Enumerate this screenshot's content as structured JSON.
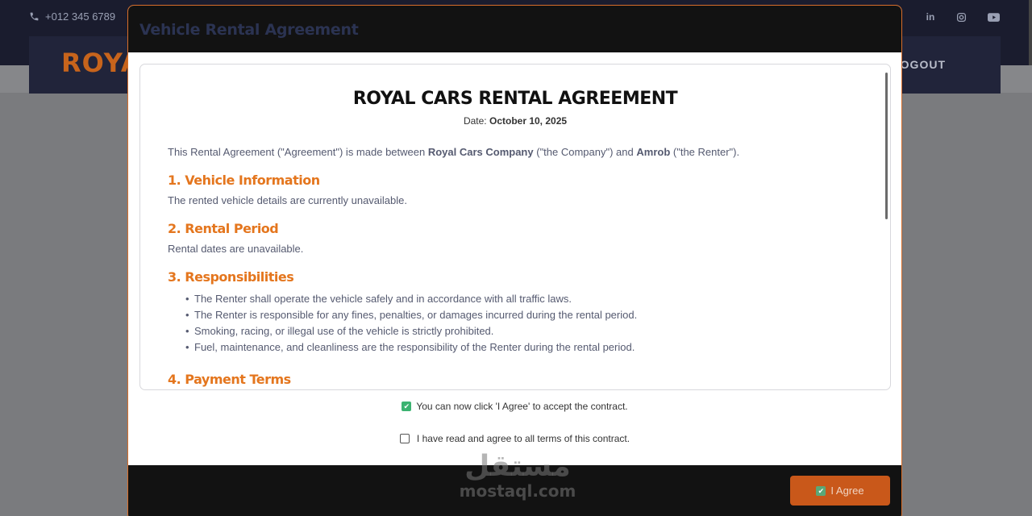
{
  "topbar": {
    "phone": "+012 345 6789",
    "social_icons": [
      "linkedin-icon",
      "instagram-icon",
      "youtube-icon"
    ]
  },
  "navbar": {
    "brand": "ROYAL",
    "logout": "LOGOUT"
  },
  "modal": {
    "title": "Vehicle Rental Agreement",
    "contract": {
      "title": "ROYAL CARS RENTAL AGREEMENT",
      "date_label": "Date:",
      "date_value": "October 10, 2025",
      "intro": {
        "prefix": "This Rental Agreement (\"Agreement\") is made between",
        "company": "Royal Cars Company",
        "mid": "(\"the Company\") and",
        "renter": "Amrob",
        "suffix": "(\"the Renter\")."
      },
      "sections": [
        {
          "heading": "1. Vehicle Information",
          "text": "The rented vehicle details are currently unavailable."
        },
        {
          "heading": "2. Rental Period",
          "text": "Rental dates are unavailable."
        },
        {
          "heading": "3. Responsibilities",
          "items": [
            "The Renter shall operate the vehicle safely and in accordance with all traffic laws.",
            "The Renter is responsible for any fines, penalties, or damages incurred during the rental period.",
            "Smoking, racing, or illegal use of the vehicle is strictly prohibited.",
            "Fuel, maintenance, and cleanliness are the responsibility of the Renter during the rental period."
          ]
        },
        {
          "heading": "4. Payment Terms"
        }
      ]
    },
    "notice": "You can now click 'I Agree' to accept the contract.",
    "agree_checkbox_label": "I have read and agree to all terms of this contract.",
    "agree_button": "I Agree"
  },
  "watermark": {
    "arabic": "مستقل",
    "latin": "mostaql.com"
  },
  "colors": {
    "accent": "#e4761e",
    "header_bg": "#121212",
    "button_bg": "#c9581a",
    "check_green": "#3cb371"
  }
}
